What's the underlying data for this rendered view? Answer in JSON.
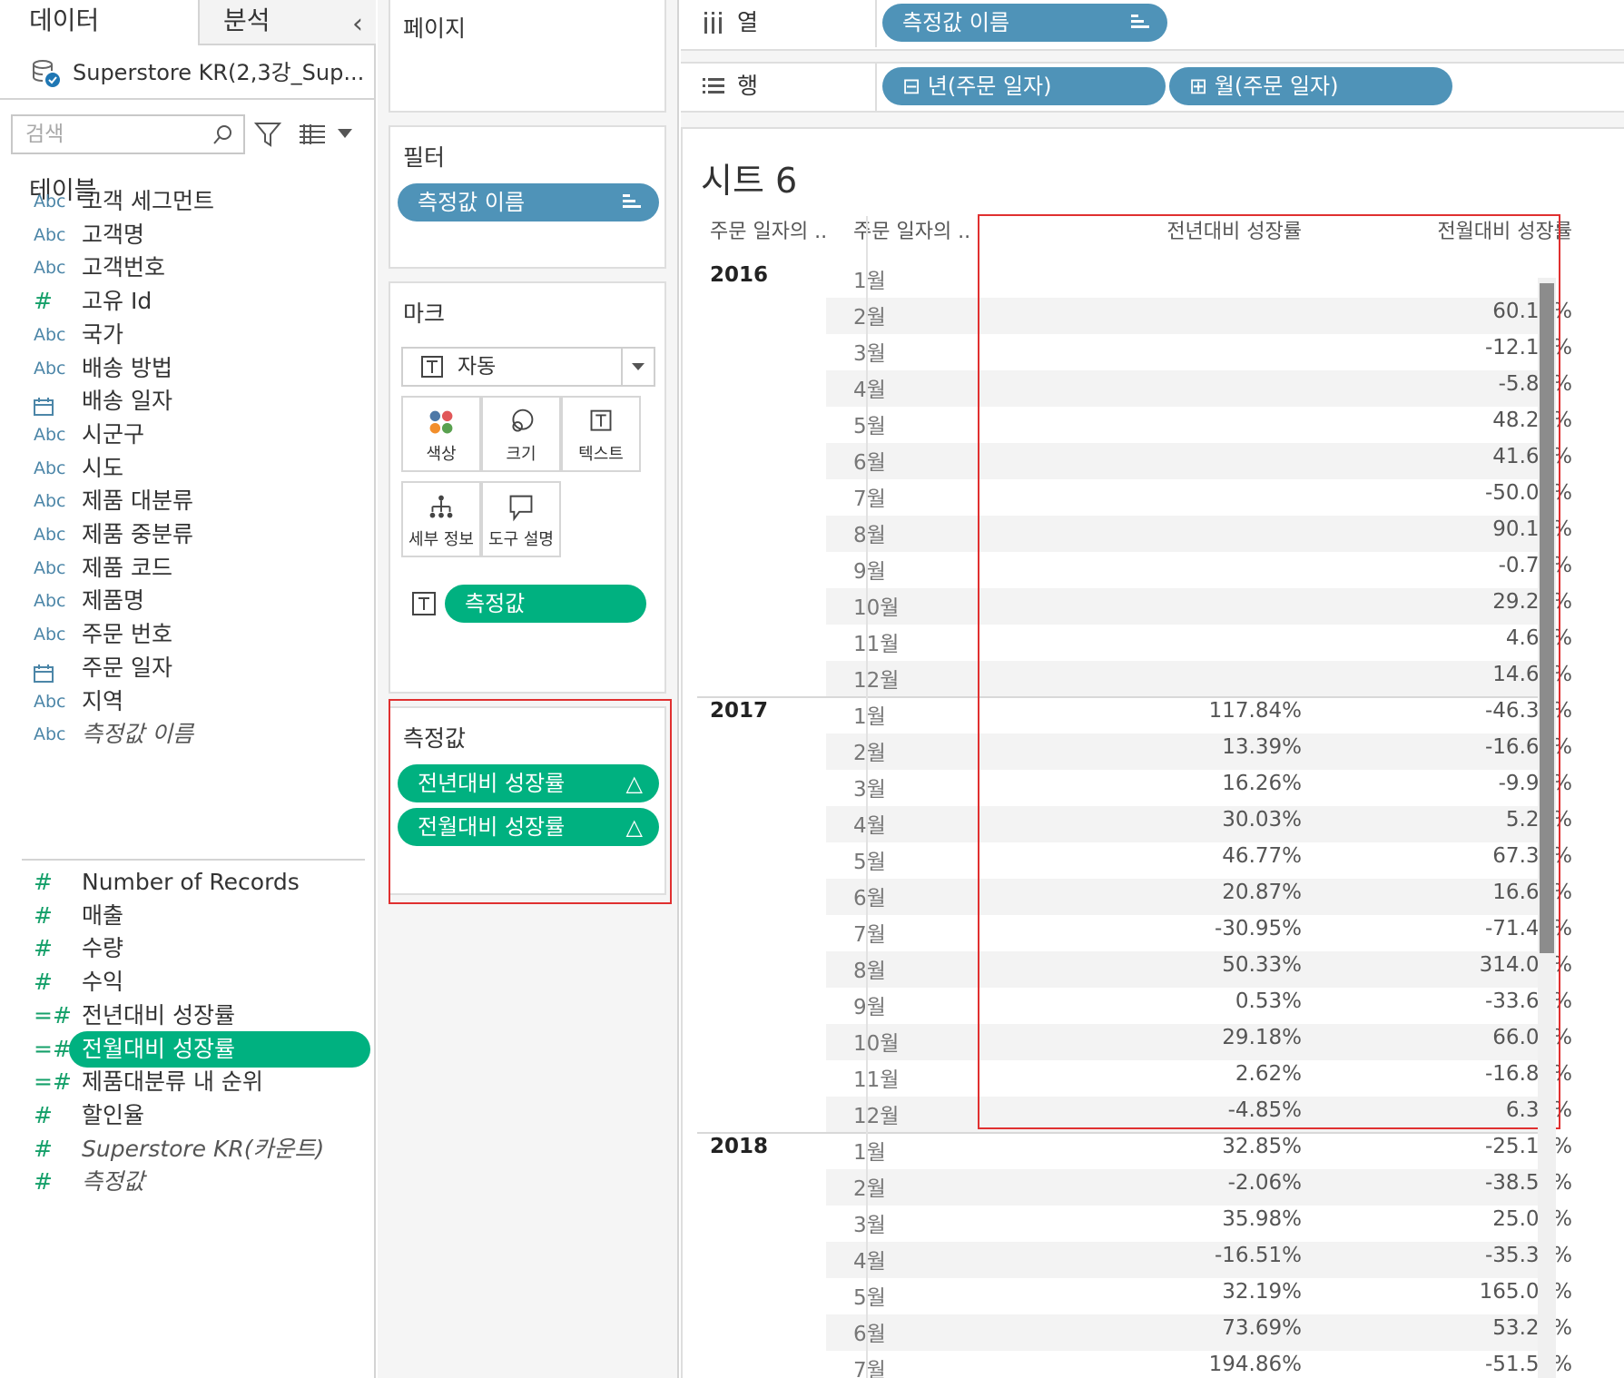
{
  "data_pane": {
    "tab_data": "데이터",
    "tab_analysis": "분석",
    "datasource": "Superstore KR(2,3강_Sup...",
    "search_placeholder": "검색",
    "tables_heading": "테이블",
    "dimensions": [
      {
        "type": "Abc",
        "name": "고객 세그먼트"
      },
      {
        "type": "Abc",
        "name": "고객명"
      },
      {
        "type": "Abc",
        "name": "고객번호"
      },
      {
        "type": "#",
        "name": "고유 Id"
      },
      {
        "type": "Abc",
        "name": "국가"
      },
      {
        "type": "Abc",
        "name": "배송 방법"
      },
      {
        "type": "calendar-icon",
        "name": "배송 일자"
      },
      {
        "type": "Abc",
        "name": "시군구"
      },
      {
        "type": "Abc",
        "name": "시도"
      },
      {
        "type": "Abc",
        "name": "제품 대분류"
      },
      {
        "type": "Abc",
        "name": "제품 중분류"
      },
      {
        "type": "Abc",
        "name": "제품 코드"
      },
      {
        "type": "Abc",
        "name": "제품명"
      },
      {
        "type": "Abc",
        "name": "주문 번호"
      },
      {
        "type": "calendar-icon",
        "name": "주문 일자"
      },
      {
        "type": "Abc",
        "name": "지역"
      },
      {
        "type": "Abc",
        "name": "측정값 이름"
      }
    ],
    "measures": [
      {
        "type": "#",
        "name": "Number of Records"
      },
      {
        "type": "#",
        "name": "매출"
      },
      {
        "type": "#",
        "name": "수량"
      },
      {
        "type": "#",
        "name": "수익"
      },
      {
        "type": "=#",
        "name": "전년대비 성장률"
      },
      {
        "type": "=#",
        "name": "전월대비 성장률"
      },
      {
        "type": "=#",
        "name": "제품대분류 내 순위"
      },
      {
        "type": "#",
        "name": "할인율"
      },
      {
        "type": "#",
        "name": "Superstore KR(카운트)"
      },
      {
        "type": "#",
        "name": "측정값"
      }
    ]
  },
  "cards": {
    "pages_title": "페이지",
    "filters_title": "필터",
    "filter_pill": "측정값 이름",
    "marks_title": "마크",
    "mark_type": "자동",
    "mark_buttons": {
      "color": "색상",
      "size": "크기",
      "text": "텍스트",
      "detail": "세부 정보",
      "tooltip": "도구 설명"
    },
    "text_pill": "측정값",
    "measure_values_title": "측정값",
    "measure_values_pills": [
      "전년대비 성장률",
      "전월대비 성장률"
    ],
    "delta_symbol": "△"
  },
  "shelves": {
    "columns_label": "열",
    "rows_label": "행",
    "columns_pill": "측정값 이름",
    "rows_pills": [
      "년(주문 일자)",
      "월(주문 일자)"
    ],
    "rows_pill_prefix": [
      "⊟",
      "⊞"
    ]
  },
  "view": {
    "sheet_title": "시트 6",
    "headers": {
      "year_col": "주문 일자의 ..",
      "month_col": "주문 일자의 ..",
      "yoy": "전년대비 성장률",
      "mom": "전월대비 성장률"
    },
    "years": [
      {
        "year": "2016",
        "rows": [
          {
            "month": "1월",
            "yoy": "",
            "mom": ""
          },
          {
            "month": "2월",
            "yoy": "",
            "mom": "60.18%"
          },
          {
            "month": "3월",
            "yoy": "",
            "mom": "-12.14%"
          },
          {
            "month": "4월",
            "yoy": "",
            "mom": "-5.88%"
          },
          {
            "month": "5월",
            "yoy": "",
            "mom": "48.29%"
          },
          {
            "month": "6월",
            "yoy": "",
            "mom": "41.60%"
          },
          {
            "month": "7월",
            "yoy": "",
            "mom": "-50.08%"
          },
          {
            "month": "8월",
            "yoy": "",
            "mom": "90.15%"
          },
          {
            "month": "9월",
            "yoy": "",
            "mom": "-0.78%"
          },
          {
            "month": "10월",
            "yoy": "",
            "mom": "29.22%"
          },
          {
            "month": "11월",
            "yoy": "",
            "mom": "4.62%"
          },
          {
            "month": "12월",
            "yoy": "",
            "mom": "14.69%"
          }
        ]
      },
      {
        "year": "2017",
        "rows": [
          {
            "month": "1월",
            "yoy": "117.84%",
            "mom": "-46.37%"
          },
          {
            "month": "2월",
            "yoy": "13.39%",
            "mom": "-16.63%"
          },
          {
            "month": "3월",
            "yoy": "16.26%",
            "mom": "-9.91%"
          },
          {
            "month": "4월",
            "yoy": "30.03%",
            "mom": "5.26%"
          },
          {
            "month": "5월",
            "yoy": "46.77%",
            "mom": "67.38%"
          },
          {
            "month": "6월",
            "yoy": "20.87%",
            "mom": "16.62%"
          },
          {
            "month": "7월",
            "yoy": "-30.95%",
            "mom": "-71.48%"
          },
          {
            "month": "8월",
            "yoy": "50.33%",
            "mom": "314.00%"
          },
          {
            "month": "9월",
            "yoy": "0.53%",
            "mom": "-33.65%"
          },
          {
            "month": "10월",
            "yoy": "29.18%",
            "mom": "66.04%"
          },
          {
            "month": "11월",
            "yoy": "2.62%",
            "mom": "-16.88%"
          },
          {
            "month": "12월",
            "yoy": "-4.85%",
            "mom": "6.34%"
          }
        ]
      },
      {
        "year": "2018",
        "rows": [
          {
            "month": "1월",
            "yoy": "32.85%",
            "mom": "-25.12%"
          },
          {
            "month": "2월",
            "yoy": "-2.06%",
            "mom": "-38.54%"
          },
          {
            "month": "3월",
            "yoy": "35.98%",
            "mom": "25.08%"
          },
          {
            "month": "4월",
            "yoy": "-16.51%",
            "mom": "-35.37%"
          },
          {
            "month": "5월",
            "yoy": "32.19%",
            "mom": "165.02%"
          },
          {
            "month": "6월",
            "yoy": "73.69%",
            "mom": "53.23%"
          },
          {
            "month": "7월",
            "yoy": "194.86%",
            "mom": "-51.58%"
          }
        ]
      }
    ]
  },
  "colors": {
    "dimension_pill": "#4f93b8",
    "measure_pill": "#00b180",
    "highlight_border": "#e03030",
    "dimension_icon": "#4c86a8",
    "measure_icon": "#15a06a"
  }
}
